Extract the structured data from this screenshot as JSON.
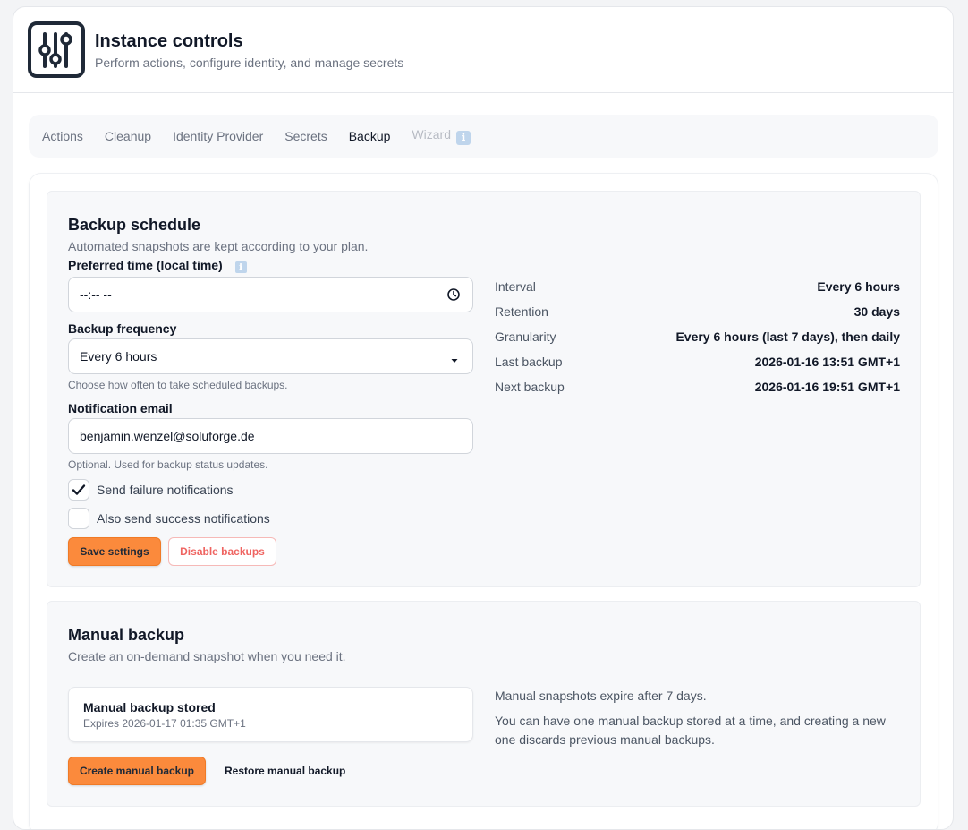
{
  "header": {
    "title": "Instance controls",
    "subtitle": "Perform actions, configure identity, and manage secrets",
    "icon": "sliders-icon"
  },
  "tabs": [
    {
      "label": "Actions",
      "state": "default"
    },
    {
      "label": "Cleanup",
      "state": "default"
    },
    {
      "label": "Identity Provider",
      "state": "default"
    },
    {
      "label": "Secrets",
      "state": "default"
    },
    {
      "label": "Backup",
      "state": "active"
    },
    {
      "label": "Wizard",
      "state": "disabled",
      "info_icon": "ℹ"
    }
  ],
  "schedule": {
    "title": "Backup schedule",
    "subtitle": "Automated snapshots are kept according to your plan.",
    "time_label": "Preferred time (local time)",
    "time_info_icon": "ℹ",
    "time_value": "--:-- --",
    "frequency_label": "Backup frequency",
    "frequency_value": "Every 6 hours",
    "frequency_hint": "Choose how often to take scheduled backups.",
    "email_label": "Notification email",
    "email_value": "benjamin.wenzel@soluforge.de",
    "email_hint": "Optional. Used for backup status updates.",
    "failure_label": "Send failure notifications",
    "failure_checked": true,
    "success_label": "Also send success notifications",
    "success_checked": false,
    "save_label": "Save settings",
    "disable_label": "Disable backups",
    "summary": [
      {
        "key": "Interval",
        "value": "Every 6 hours"
      },
      {
        "key": "Retention",
        "value": "30 days"
      },
      {
        "key": "Granularity",
        "value": "Every 6 hours (last 7 days), then daily"
      },
      {
        "key": "Last backup",
        "value": "2026-01-16 13:51 GMT+1"
      },
      {
        "key": "Next backup",
        "value": "2026-01-16 19:51 GMT+1"
      }
    ]
  },
  "manual": {
    "title": "Manual backup",
    "subtitle": "Create an on-demand snapshot when you need it.",
    "stored_title": "Manual backup stored",
    "stored_expires": "Expires 2026-01-17 01:35 GMT+1",
    "note1": "Manual snapshots expire after 7 days.",
    "note2": "You can have one manual backup stored at a time, and creating a new one discards previous manual backups.",
    "create_label": "Create manual backup",
    "restore_label": "Restore manual backup"
  },
  "colors": {
    "accent": "#fb8a3c",
    "danger": "#ef6461"
  }
}
